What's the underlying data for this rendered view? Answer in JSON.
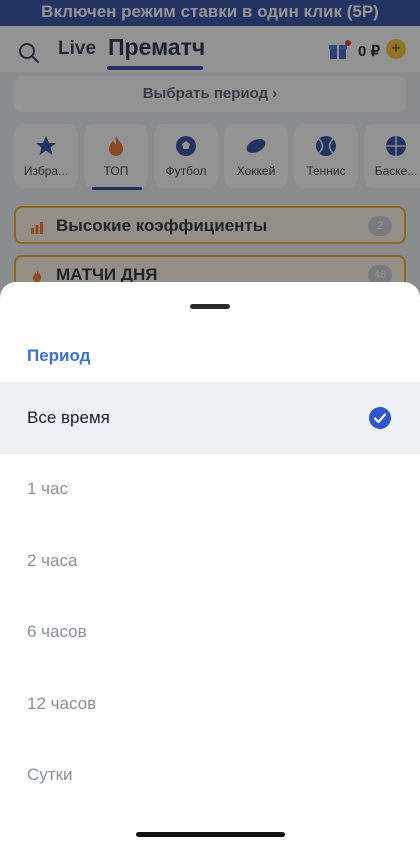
{
  "banner": {
    "text": "Включен режим ставки в один клик (5Р)"
  },
  "header": {
    "tab_live": "Live",
    "tab_prematch": "Прематч",
    "balance": "0 ₽",
    "plus": "+"
  },
  "period_button": {
    "label": "Выбрать период",
    "chevron": "›"
  },
  "sports": [
    {
      "label": "Избра...",
      "icon": "star-icon"
    },
    {
      "label": "ТОП",
      "icon": "fire-icon"
    },
    {
      "label": "Футбол",
      "icon": "soccer-ball-icon"
    },
    {
      "label": "Хоккей",
      "icon": "hockey-puck-icon"
    },
    {
      "label": "Теннис",
      "icon": "tennis-ball-icon"
    },
    {
      "label": "Баске...",
      "icon": "basketball-icon"
    }
  ],
  "sections": [
    {
      "title": "Высокие коэффициенты",
      "count": "2"
    },
    {
      "title": "МАТЧИ ДНЯ",
      "count": "48"
    }
  ],
  "sheet": {
    "title": "Период",
    "options": [
      {
        "label": "Все время",
        "selected": true
      },
      {
        "label": "1 час",
        "selected": false
      },
      {
        "label": "2 часа",
        "selected": false
      },
      {
        "label": "6 часов",
        "selected": false
      },
      {
        "label": "12 часов",
        "selected": false
      },
      {
        "label": "Сутки",
        "selected": false
      }
    ]
  },
  "colors": {
    "accent": "#3e6fd1",
    "check": "#2c56c9",
    "brand_dark": "#1e3f9a",
    "highlight_border": "#f7a21b"
  }
}
